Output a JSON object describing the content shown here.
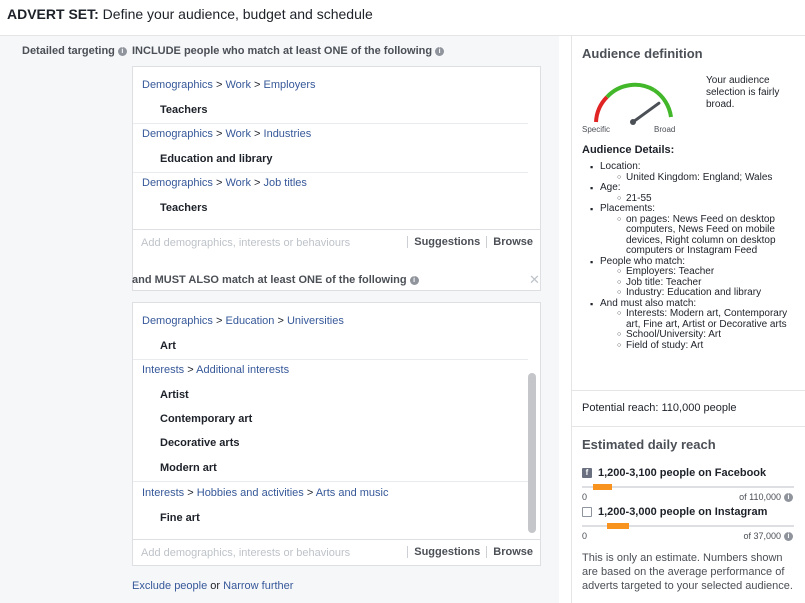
{
  "header": {
    "prefix": "ADVERT SET:",
    "title": " Define your audience, budget and schedule"
  },
  "targeting": {
    "label": "Detailed targeting",
    "include_title": "INCLUDE people who match at least ONE of the following",
    "include_items": [
      {
        "path": [
          "Demographics",
          "Work",
          "Employers"
        ],
        "value": "Teachers"
      },
      {
        "path": [
          "Demographics",
          "Work",
          "Industries"
        ],
        "value": "Education and library"
      },
      {
        "path": [
          "Demographics",
          "Work",
          "Job titles"
        ],
        "value": "Teachers"
      }
    ],
    "must_title": "and MUST ALSO match at least ONE of the following",
    "must_groups": [
      {
        "path": [
          "Demographics",
          "Education",
          "Universities"
        ],
        "values": [
          "Art"
        ]
      },
      {
        "path": [
          "Interests",
          "Additional interests"
        ],
        "values": [
          "Artist",
          "Contemporary art",
          "Decorative arts",
          "Modern art"
        ]
      },
      {
        "path": [
          "Interests",
          "Hobbies and activities",
          "Arts and music"
        ],
        "values": [
          "Fine art"
        ]
      }
    ],
    "add_placeholder": "Add demographics, interests or behaviours",
    "suggestions": "Suggestions",
    "browse": "Browse",
    "exclude_link": "Exclude people",
    "or_text": "or",
    "narrow_link": "Narrow further",
    "sep": ">"
  },
  "audience": {
    "title": "Audience definition",
    "gauge_specific": "Specific",
    "gauge_broad": "Broad",
    "gauge_level": 0.8,
    "summary": "Your audience selection is fairly broad.",
    "details_title": "Audience Details:",
    "details": [
      {
        "label": "Location:",
        "items": [
          "United Kingdom: England; Wales"
        ]
      },
      {
        "label": "Age:",
        "items": [
          "21-55"
        ]
      },
      {
        "label": "Placements:",
        "items": [
          "on pages: News Feed on desktop computers, News Feed on mobile devices, Right column on desktop computers or Instagram Feed"
        ]
      },
      {
        "label": "People who match:",
        "items": [
          "Employers: Teacher",
          "Job title: Teacher",
          "Industry: Education and library"
        ]
      },
      {
        "label": "And must also match:",
        "items": [
          "Interests: Modern art, Contemporary art, Fine art, Artist or Decorative arts",
          "School/University: Art",
          "Field of study: Art"
        ]
      }
    ],
    "potential_reach": "Potential reach: 110,000 people"
  },
  "reach": {
    "title": "Estimated daily reach",
    "facebook": {
      "label": "1,200-3,100 people on Facebook",
      "min": "0",
      "max": "of 110,000",
      "fill_start": 0.05,
      "fill_end": 0.14
    },
    "instagram": {
      "label": "1,200-3,000 people on Instagram",
      "min": "0",
      "max": "of 37,000",
      "fill_start": 0.12,
      "fill_end": 0.22
    },
    "disclaimer": "This is only an estimate. Numbers shown are based on the average performance of adverts targeted to your selected audience."
  }
}
